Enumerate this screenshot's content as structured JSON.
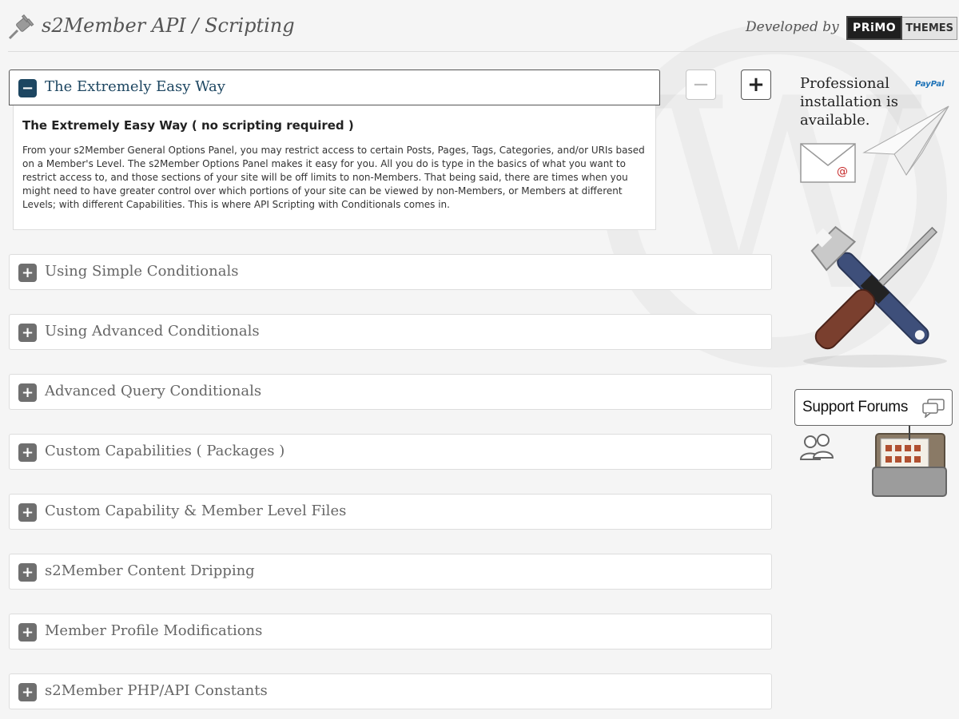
{
  "header": {
    "title": "s2Member API / Scripting",
    "developed_by": "Developed by",
    "logo_left": "PRiMO",
    "logo_right": "THEMES"
  },
  "controls": {
    "collapse_all": "−",
    "expand_all": "+"
  },
  "sections": [
    {
      "label": "The Extremely Easy Way",
      "toggle": "−",
      "open": true
    },
    {
      "label": "Using Simple Conditionals",
      "toggle": "+"
    },
    {
      "label": "Using Advanced Conditionals",
      "toggle": "+"
    },
    {
      "label": "Advanced Query Conditionals",
      "toggle": "+"
    },
    {
      "label": "Custom Capabilities ( Packages )",
      "toggle": "+"
    },
    {
      "label": "Custom Capability & Member Level Files",
      "toggle": "+"
    },
    {
      "label": "s2Member Content Dripping",
      "toggle": "+"
    },
    {
      "label": "Member Profile Modifications",
      "toggle": "+"
    },
    {
      "label": "s2Member PHP/API Constants",
      "toggle": "+"
    }
  ],
  "open_section": {
    "title": "The Extremely Easy Way ( no scripting required )",
    "text": "From your s2Member General Options Panel, you may restrict access to certain Posts, Pages, Tags, Categories, and/or URIs based on a Member's Level. The s2Member Options Panel makes it easy for you. All you do is type in the basics of what you want to restrict access to, and those sections of your site will be off limits to non-Members. That being said, there are times when you might need to have greater control over which portions of your site can be viewed by non-Members, or Members at different Levels; with different Capabilities. This is where API Scripting with Conditionals comes in."
  },
  "sidebar": {
    "promo_text": "Professional\ninstallation is\navailable.",
    "paypal": "PayPal",
    "envelope_symbol": "@",
    "support_label": "Support Forums"
  },
  "icons": {
    "header": "plug-icon",
    "envelope": "envelope-icon",
    "plane": "paper-plane-icon",
    "tools": "wrench-screwdriver-icon",
    "chat": "chat-bubbles-icon",
    "users": "users-icon",
    "folder": "folder-icon"
  },
  "colors": {
    "open_accent": "#1d4661",
    "toggle_gray": "#6f6f6f",
    "paypal_blue": "#1f73b7"
  }
}
